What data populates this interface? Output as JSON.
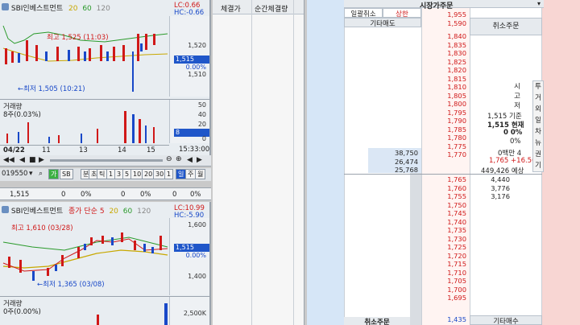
{
  "top_chart": {
    "name": "SBI인베스트먼트",
    "ma": [
      "20",
      "60",
      "120"
    ],
    "lc": "LC:0.66",
    "hc": "HC:-0.66",
    "high_label": "최고 1,525 (11:03)",
    "low_label": "←최저 1,505 (10:21)",
    "ticks": [
      "1,520",
      "1,515",
      "0.00%",
      "1,510"
    ],
    "current_badge": "1,515",
    "volume_title": "거래량",
    "volume_sub": "8주(0.03%)",
    "vol_ticks": [
      "50",
      "40",
      "20",
      "8",
      "0"
    ],
    "dates": [
      "04/22",
      "11",
      "13",
      "14",
      "15",
      "15:33:00"
    ],
    "toolbar_code": "019550",
    "toolbar_items": [
      "SB",
      "분",
      "초",
      "틱",
      "1",
      "3",
      "5",
      "10",
      "20",
      "30",
      "1",
      "일",
      "주",
      "월"
    ]
  },
  "mid_row": {
    "price": "1,515",
    "v1": "0",
    "v2": "0%",
    "v3": "0",
    "v4": "0%",
    "v5": "0",
    "v6": "0%"
  },
  "bottom_chart": {
    "name": "SBI인베스트먼트",
    "extra": "종가 단순 5",
    "ma": [
      "20",
      "60",
      "120"
    ],
    "lc": "LC:10.99",
    "hc": "HC:-5.90",
    "high_label": "최고 1,610 (03/28)",
    "low_label": "←최저 1,365 (03/08)",
    "ticks": [
      "1,600",
      "1,515",
      "0.00%",
      "1,400"
    ],
    "current_badge": "1,515",
    "volume_title": "거래량",
    "volume_sub": "0주(0.00%)",
    "vol_ticks": [
      "2,500K"
    ]
  },
  "exec_panel": {
    "col1": "체결가",
    "col2": "순간체결량"
  },
  "orderbook": {
    "title": "시장가주문",
    "cancel_all": "일괄취소",
    "upper_limit": "상한",
    "etc_sell": "기타매도",
    "cancel_order": "취소주문",
    "etc_buy": "기타매수",
    "cancel_order_bottom": "취소주문",
    "top_prices": [
      "1,955",
      "1,590"
    ],
    "ask_prices": [
      "1,840",
      "1,835",
      "1,830",
      "1,825",
      "1,820",
      "1,815",
      "1,810",
      "1,805",
      "1,800",
      "1,795",
      "1,790",
      "1,785",
      "1,780",
      "1,775",
      "1,770"
    ],
    "ask_qty": {
      "1,780": "38,750",
      "1,775": "26,474",
      "1,770": "25,768"
    },
    "bid_prices": [
      "1,765",
      "1,760",
      "1,755",
      "1,750",
      "1,745",
      "1,740",
      "1,735",
      "1,730",
      "1,725",
      "1,720",
      "1,715",
      "1,710",
      "1,705",
      "1,700",
      "1,695"
    ],
    "bid_qty": {
      "1,765": "4,440",
      "1,760": "3,776",
      "1,755": "3,176"
    },
    "bottom_price": "1,435",
    "info_vertical": [
      "시",
      "고",
      "저"
    ],
    "info": {
      "base": "1,515 기준",
      "current": "1,515 현재",
      "zero_pct": "0 0%",
      "pct": "0%",
      "amount": "0백만 4",
      "expected": "1,765 +16.50",
      "expected_qty": "449,426 예상"
    },
    "side_tabs": [
      "투",
      "거",
      "외",
      "일",
      "차",
      "뉴",
      "권",
      "기"
    ]
  },
  "colors": {
    "up": "#d01818",
    "down": "#1848c8",
    "badge": "#1f56c9"
  }
}
